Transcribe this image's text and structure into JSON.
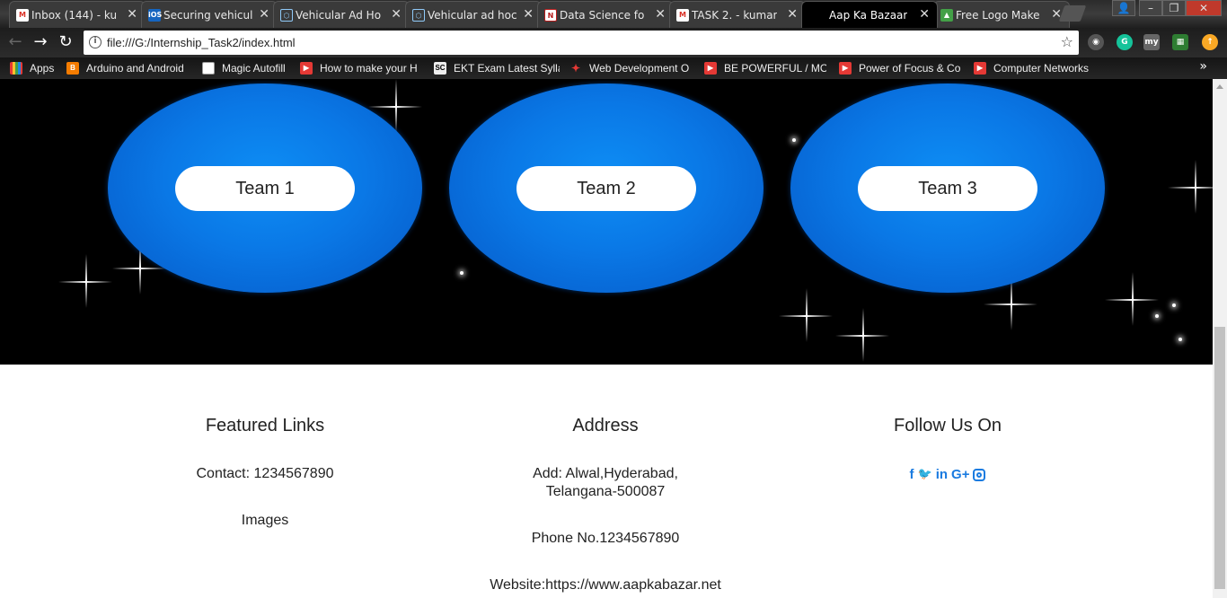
{
  "browser": {
    "tabs": [
      {
        "title": "Inbox (144) - ku",
        "icon": "gmail-icon",
        "color": "#d93025",
        "active": false
      },
      {
        "title": "Securing vehicul",
        "icon": "ios-icon",
        "color": "#1565c0",
        "active": false
      },
      {
        "title": "Vehicular Ad Ho",
        "icon": "document-icon",
        "color": "#5c6bc0",
        "active": false
      },
      {
        "title": "Vehicular ad hoc",
        "icon": "document-icon",
        "color": "#5c6bc0",
        "active": false
      },
      {
        "title": "Data Science fo",
        "icon": "notion-icon",
        "color": "#b71c1c",
        "active": false
      },
      {
        "title": "TASK 2. - kumar",
        "icon": "gmail-icon",
        "color": "#d93025",
        "active": false
      },
      {
        "title": "Aap Ka Bazaar",
        "icon": "",
        "color": "#000000",
        "active": true
      },
      {
        "title": "Free Logo Make",
        "icon": "logo-maker-icon",
        "color": "#43a047",
        "active": false
      }
    ],
    "url": "file:///G:/Internship_Task2/index.html",
    "bookmarks": [
      {
        "label": "Apps",
        "icon": "apps-grid-icon"
      },
      {
        "label": "Arduino and Android",
        "icon": "blogger-icon"
      },
      {
        "label": "Magic Autofill",
        "icon": "page-icon"
      },
      {
        "label": "How to make your H",
        "icon": "youtube-icon"
      },
      {
        "label": "EKT Exam Latest Sylla",
        "icon": "sc-icon"
      },
      {
        "label": "Web Development O",
        "icon": "web-icon"
      },
      {
        "label": "BE POWERFUL / MOT",
        "icon": "youtube-icon"
      },
      {
        "label": "Power of Focus & Co",
        "icon": "youtube-icon"
      },
      {
        "label": "Computer Networks",
        "icon": "youtube-icon"
      }
    ],
    "more": "»"
  },
  "teams": [
    {
      "label": "Team 1"
    },
    {
      "label": "Team 2"
    },
    {
      "label": "Team 3"
    }
  ],
  "footer": {
    "featured": {
      "heading": "Featured Links",
      "contact": "Contact: 1234567890",
      "images": "Images"
    },
    "address": {
      "heading": "Address",
      "add_line1": "Add: Alwal,Hyderabad,",
      "add_line2": "Telangana-500087",
      "phone": "Phone No.1234567890",
      "website": "Website:https://www.aapkabazar.net"
    },
    "follow": {
      "heading": "Follow Us On",
      "icons": [
        "facebook-icon",
        "twitter-icon",
        "linkedin-icon",
        "google-plus-icon",
        "instagram-icon"
      ],
      "facebook_glyph": "f",
      "twitter_glyph": "🐦",
      "linkedin_glyph": "in",
      "gplus_glyph": "G+"
    }
  },
  "colors": {
    "accent": "#1a7be0",
    "team_blue": "#0a78e6"
  }
}
